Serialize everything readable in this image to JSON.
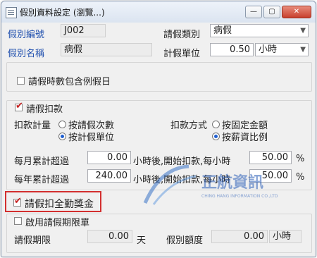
{
  "window": {
    "title": "假別資料設定 (瀏覽...)",
    "min_glyph": "—",
    "restore_glyph": "▢",
    "close_glyph": "✕"
  },
  "fields": {
    "leave_code_label": "假別編號",
    "leave_code_value": "J002",
    "leave_type_label": "請假類別",
    "leave_type_value": "病假",
    "leave_name_label": "假別名稱",
    "leave_name_value": "病假",
    "unit_label": "計假單位",
    "unit_value": "0.50",
    "unit_select": "小時"
  },
  "holiday_option": {
    "label": "請假時數包含例假日",
    "checked": false
  },
  "deduction": {
    "title": "請假扣款",
    "checked": true,
    "calc_label": "扣款計量",
    "calc_option1": "按請假次數",
    "calc_option2": "按計假單位",
    "calc_selected": 2,
    "method_label": "扣款方式",
    "method_option1": "按固定金額",
    "method_option2": "按薪資比例",
    "method_selected": 2,
    "monthly_label": "每月累計超過",
    "monthly_value": "0.00",
    "monthly_text": "小時後,開始扣款,每小時",
    "monthly_pct": "50.00",
    "monthly_unit": "%",
    "yearly_label": "每年累計超過",
    "yearly_value": "240.00",
    "yearly_text": "小時後,開始扣款,每小時",
    "yearly_pct": "50.00",
    "yearly_unit": "%"
  },
  "bonus_deduct": {
    "label": "請假扣全勤獎金",
    "checked": true
  },
  "limit": {
    "title": "啟用請假期限單",
    "checked": false,
    "period_label": "請假期限",
    "period_value": "0.00",
    "period_unit": "天",
    "quota_label": "假別額度",
    "quota_value": "0.00",
    "quota_unit": "小時"
  },
  "watermark": {
    "brand": "正航資訊",
    "sub": "CHING HANG INFORMATION CO.,LTD"
  }
}
